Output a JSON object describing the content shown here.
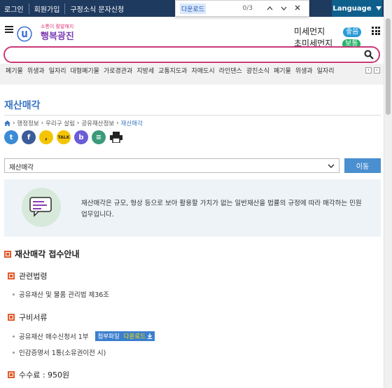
{
  "topbar": {
    "links": [
      "로그인",
      "회원가입",
      "구정소식 문자신청"
    ],
    "language_label": "Language"
  },
  "findbar": {
    "query": "다운로드",
    "count": "0/3"
  },
  "header": {
    "logo_small": "소통이 활발해지는",
    "logo_big": "행복광진",
    "fine_dust_label": "미세먼지",
    "fine_dust_status": "좋음",
    "ultrafine_dust_label": "초미세먼지",
    "ultrafine_dust_status": "보통"
  },
  "search": {
    "placeholder": ""
  },
  "keywords": [
    "폐기물",
    "위생과",
    "일자리",
    "대형폐기물",
    "가로경관과",
    "지방세",
    "교통지도과",
    "자매도시",
    "라인댄스",
    "광진소식",
    "폐기물",
    "위생과",
    "일자리"
  ],
  "page": {
    "title": "재산매각",
    "breadcrumb": [
      "행정정보",
      "우리구 살림",
      "공유재산정보",
      "재산매각"
    ],
    "select_value": "재산매각",
    "go_button": "이동",
    "info_text": "재산매각은 규모, 형상 등으로 보아 활용할 가치가 없는 일반재산을 법률의 규정에 따라 매각하는 민원 업무입니다."
  },
  "sections": {
    "main_title": "재산매각 접수안내",
    "law_title": "관련법령",
    "law_item": "공유재산 및 물품 관리법 제36조",
    "docs_title": "구비서류",
    "doc_item_1": "공유재산 매수신청서 1부",
    "attach_label": "첨부파일",
    "download_label": "다운로드",
    "doc_item_2": "인감증명서 1통(소유권이전 시)",
    "fee_text": "수수료 : 950원"
  },
  "colors": {
    "topbar": "#1f3a5f",
    "accent": "#3a76c4",
    "search_border": "#c93a78",
    "section_marker": "#e25a2b"
  }
}
